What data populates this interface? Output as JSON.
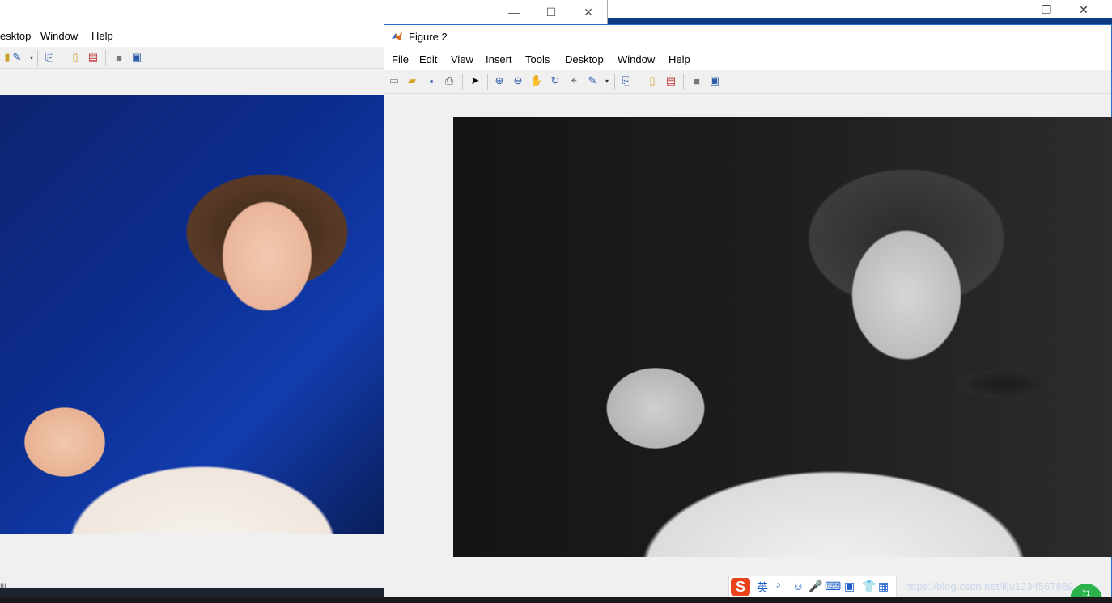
{
  "background_window": {
    "controls": [
      "—",
      "❐",
      "✕"
    ]
  },
  "figure1": {
    "controls": [
      "—",
      "☐",
      "✕"
    ],
    "menu": [
      "esktop",
      "Window",
      "Help"
    ],
    "bottom_text": "III"
  },
  "figure2": {
    "title": "Figure 2",
    "minimize": "—",
    "menu": [
      "File",
      "Edit",
      "View",
      "Insert",
      "Tools",
      "Desktop",
      "Window",
      "Help"
    ]
  },
  "ime": {
    "logo": "S",
    "mode": "英",
    "items": [
      "ᵓ",
      "☺",
      "🎤",
      "⌨",
      "▣",
      "👕",
      "▦"
    ]
  },
  "watermark": "https://blog.csdn.net/liju1234567869",
  "badge": "71",
  "colors": {
    "window_border": "#2b6cc4",
    "ime_logo": "#e8431b"
  }
}
